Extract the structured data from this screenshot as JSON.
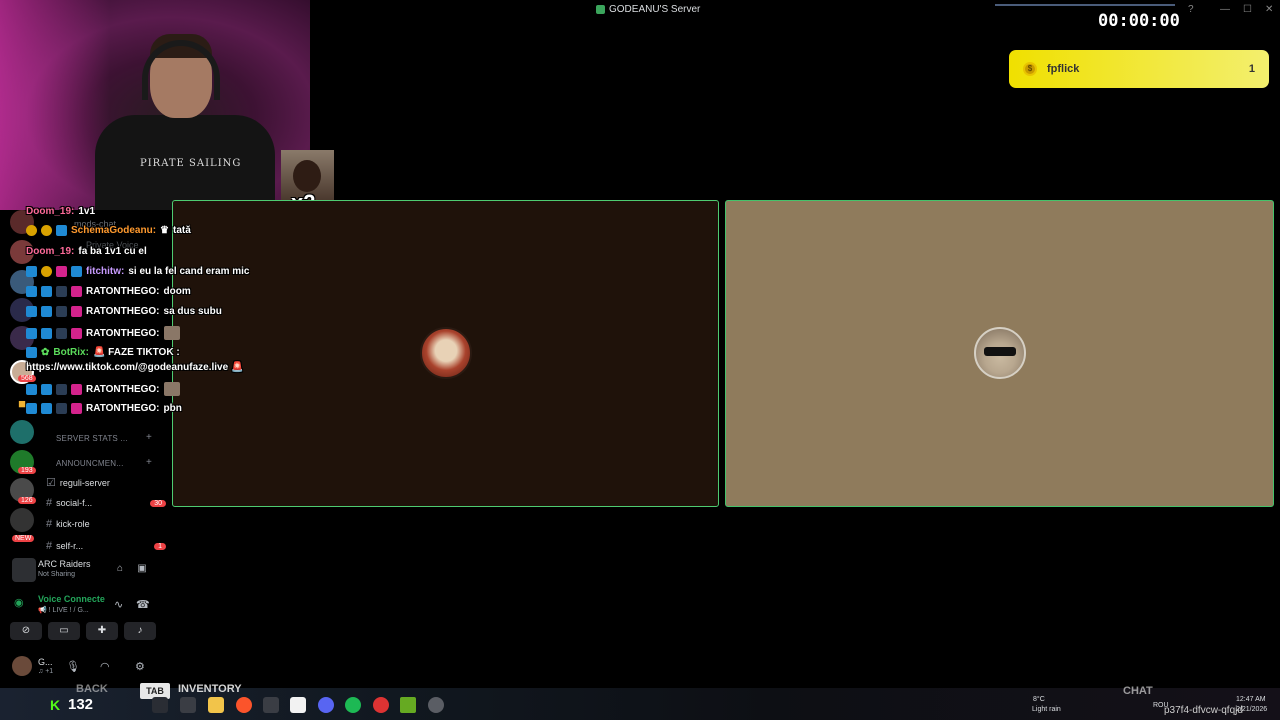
{
  "window": {
    "title": "GODEANU'S Server"
  },
  "stream": {
    "timer": "00:00:00",
    "meme_label": "x2",
    "shirt_text": "PIRATE SAILING",
    "notification": {
      "name": "fpflick",
      "count": "1"
    }
  },
  "sidebar": {
    "overlay_channels": [
      {
        "label": "mods-chat"
      },
      {
        "label": "Private Voice"
      }
    ],
    "categories": [
      {
        "label": "SERVER STATS ..."
      },
      {
        "label": "ANNOUNCMEN..."
      }
    ],
    "channels": [
      {
        "label": "reguli-server",
        "badge": ""
      },
      {
        "label": "social-f...",
        "badge": "30"
      },
      {
        "label": "kick-role",
        "badge": ""
      },
      {
        "label": "self-r...",
        "badge": "1"
      }
    ],
    "server_badges": [
      "193",
      "126",
      "NEW",
      "568"
    ],
    "activity": {
      "title": "ARC Raiders",
      "subtitle": "Not Sharing"
    },
    "voice": {
      "title": "Voice Connecte",
      "subtitle": "📢 ! LIVE ! / G..."
    },
    "user": {
      "name": "G...",
      "status": "♫ +1"
    }
  },
  "chat": [
    {
      "user": "Doom_19:",
      "msg": "1v1"
    },
    {
      "user": "SchemaGodeanu:",
      "msg": "tată"
    },
    {
      "user": "Doom_19:",
      "msg": "fa ba 1v1 cu el"
    },
    {
      "user": "fitchitw:",
      "msg": "si eu la fel cand eram mic"
    },
    {
      "user": "RATONTHEGO:",
      "msg": "doom"
    },
    {
      "user": "RATONTHEGO:",
      "msg": "sa dus subu"
    },
    {
      "user": "RATONTHEGO:",
      "msg": ""
    },
    {
      "user": "BotRix:",
      "msg": "🚨 FAZE TIKTOK :"
    },
    {
      "user": "",
      "msg": "https://www.tiktok.com/@godeanufaze.live 🚨"
    },
    {
      "user": "RATONTHEGO:",
      "msg": ""
    },
    {
      "user": "RATONTHEGO:",
      "msg": "pbn"
    }
  ],
  "game_hud": {
    "back": "BACK",
    "tab": "TAB",
    "inventory": "INVENTORY",
    "ammo": "132",
    "chat": "CHAT"
  },
  "taskbar": {
    "weather_temp": "8°C",
    "weather_desc": "Light rain",
    "lang": "ROU",
    "time": "12:47 AM",
    "date": "2/21/2026",
    "code": "p37f4-dfvcw-qfqjd"
  }
}
